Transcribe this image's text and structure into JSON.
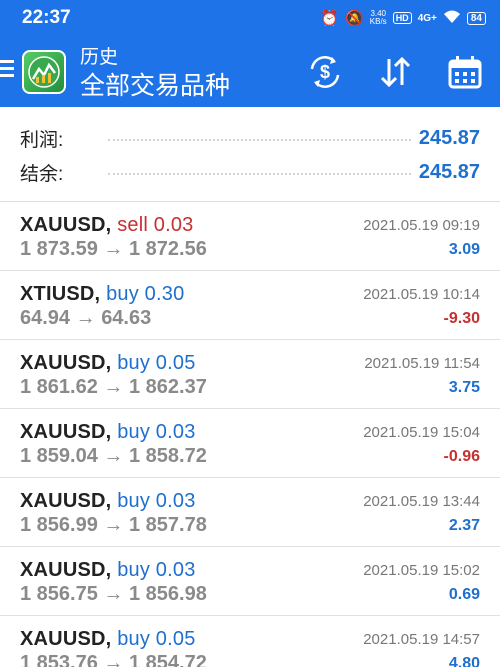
{
  "status_bar": {
    "time": "22:37",
    "net_speed_value": "3.40",
    "net_speed_unit": "KB/s",
    "hd_badge": "HD",
    "signal_label": "4G+",
    "battery": "84"
  },
  "header": {
    "small_title": "历史",
    "main_title": "全部交易品种",
    "icons": [
      "menu-icon",
      "metatrader-logo",
      "currency-exchange-icon",
      "sort-icon",
      "calendar-icon"
    ]
  },
  "summary": {
    "profit_label": "利润:",
    "profit_value": "245.87",
    "balance_label": "结余:",
    "balance_value": "245.87"
  },
  "trades": [
    {
      "symbol": "XAUUSD,",
      "side": "sell 0.03",
      "from": "1 873.59",
      "arrow": "→",
      "to": "1 872.56",
      "time": "2021.05.19 09:19",
      "profit": "3.09"
    },
    {
      "symbol": "XTIUSD,",
      "side": "buy 0.30",
      "from": "64.94",
      "arrow": "→",
      "to": "64.63",
      "time": "2021.05.19 10:14",
      "profit": "-9.30"
    },
    {
      "symbol": "XAUUSD,",
      "side": "buy 0.05",
      "from": "1 861.62",
      "arrow": "→",
      "to": "1 862.37",
      "time": "2021.05.19 11:54",
      "profit": "3.75"
    },
    {
      "symbol": "XAUUSD,",
      "side": "buy 0.03",
      "from": "1 859.04",
      "arrow": "→",
      "to": "1 858.72",
      "time": "2021.05.19 15:04",
      "profit": "-0.96"
    },
    {
      "symbol": "XAUUSD,",
      "side": "buy 0.03",
      "from": "1 856.99",
      "arrow": "→",
      "to": "1 857.78",
      "time": "2021.05.19 13:44",
      "profit": "2.37"
    },
    {
      "symbol": "XAUUSD,",
      "side": "buy 0.03",
      "from": "1 856.75",
      "arrow": "→",
      "to": "1 856.98",
      "time": "2021.05.19 15:02",
      "profit": "0.69"
    },
    {
      "symbol": "XAUUSD,",
      "side": "buy 0.05",
      "from": "1 853.76",
      "arrow": "→",
      "to": "1 854.72",
      "time": "2021.05.19 14:57",
      "profit": "4.80"
    }
  ],
  "colors": {
    "header_bg": "#1f73e8",
    "profit_positive": "#1f6fcf",
    "profit_negative": "#c63030",
    "sell": "#c63030",
    "buy": "#1f6fcf"
  }
}
